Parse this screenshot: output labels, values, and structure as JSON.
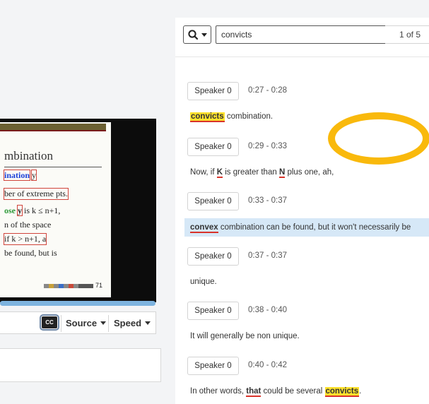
{
  "search": {
    "query": "convicts",
    "result_count": "1 of 5",
    "icon": "magnifier-icon"
  },
  "player": {
    "controls": {
      "cc_label": "CC",
      "source_label": "Source",
      "speed_label": "Speed"
    },
    "slide": {
      "title": "mbination",
      "line1_word": "ination",
      "line1_var": "y",
      "line2": "ber of extreme pts.",
      "line3_a": "ose",
      "line3_b": "y",
      "line3_c": "is k ≤ n+1,",
      "line4": "n of the space",
      "line5": "if k > n+1, a",
      "line6": "be found, but is",
      "page_number": "71"
    }
  },
  "transcript": {
    "segments": [
      {
        "speaker": "Speaker 0",
        "time": "0:27 - 0:28",
        "parts": [
          {
            "text": "convicts",
            "style": "match-current"
          },
          {
            "text": " combination.",
            "style": "plain"
          }
        ]
      },
      {
        "speaker": "Speaker 0",
        "time": "0:29 - 0:33",
        "parts": [
          {
            "text": "Now, if ",
            "style": "plain"
          },
          {
            "text": "K",
            "style": "keyword"
          },
          {
            "text": " is greater than ",
            "style": "plain"
          },
          {
            "text": "N",
            "style": "keyword"
          },
          {
            "text": " plus one, ah,",
            "style": "plain"
          }
        ]
      },
      {
        "speaker": "Speaker 0",
        "time": "0:33 - 0:37",
        "highlighted": true,
        "parts": [
          {
            "text": "convex",
            "style": "keyword"
          },
          {
            "text": " combination can be found, but it won't necessarily be",
            "style": "plain"
          }
        ]
      },
      {
        "speaker": "Speaker 0",
        "time": "0:37 - 0:37",
        "parts": [
          {
            "text": "unique.",
            "style": "plain"
          }
        ]
      },
      {
        "speaker": "Speaker 0",
        "time": "0:38 - 0:40",
        "parts": [
          {
            "text": "It will generally be non unique.",
            "style": "plain"
          }
        ]
      },
      {
        "speaker": "Speaker 0",
        "time": "0:40 - 0:42",
        "parts": [
          {
            "text": "In other words, ",
            "style": "plain"
          },
          {
            "text": "that",
            "style": "keyword"
          },
          {
            "text": " could be several ",
            "style": "plain"
          },
          {
            "text": "convicts",
            "style": "match"
          },
          {
            "text": ".",
            "style": "plain"
          }
        ]
      }
    ]
  },
  "colors": {
    "match_highlight": "#fde12c",
    "keyword_underline": "#d9342b",
    "active_row": "#d6e8f7",
    "search_ring": "#f9b90c",
    "progress": "#7db3df"
  }
}
